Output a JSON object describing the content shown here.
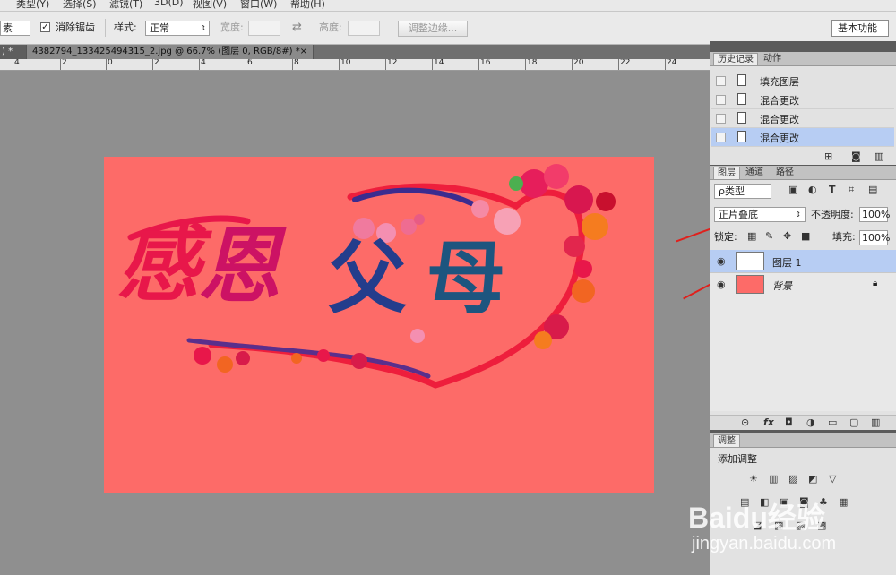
{
  "menu": [
    "类型(Y)",
    "选择(S)",
    "滤镜(T)",
    "3D(D)",
    "视图(V)",
    "窗口(W)",
    "帮助(H)"
  ],
  "options": {
    "feather_unit": "素",
    "antialias_label": "消除锯齿",
    "style_label": "样式:",
    "style_value": "正常",
    "width_label": "宽度:",
    "height_label": "高度:",
    "refine_edge": "调整边缘...",
    "workspace": "基本功能"
  },
  "tabs": [
    {
      "label": ") *"
    },
    {
      "label": "4382794_133425494315_2.jpg @ 66.7% (图层 0, RGB/8#) *"
    }
  ],
  "ruler_numbers": [
    "4",
    "2",
    "0",
    "2",
    "4",
    "6",
    "8",
    "10",
    "12",
    "14",
    "16",
    "18",
    "20",
    "22",
    "24"
  ],
  "artwork": {
    "chars": [
      "感",
      "恩",
      "父",
      "母"
    ],
    "colors": {
      "background": "#fd6b68",
      "left_text": "#e8174a",
      "right_text": "#1d4d8c",
      "heart": "#ee1e3c"
    }
  },
  "history_panel": {
    "tabs": [
      "历史记录",
      "动作"
    ],
    "items": [
      {
        "label": "填充图层",
        "selected": false
      },
      {
        "label": "混合更改",
        "selected": false
      },
      {
        "label": "混合更改",
        "selected": false
      },
      {
        "label": "混合更改",
        "selected": true
      }
    ]
  },
  "layers_panel": {
    "tabs": [
      "图层",
      "通道",
      "路径"
    ],
    "filter_label": "ρ类型",
    "blend_mode": "正片叠底",
    "opacity_label": "不透明度:",
    "opacity_value": "100%",
    "lock_label": "锁定:",
    "fill_label": "填充:",
    "fill_value": "100%",
    "layers": [
      {
        "name": "图层 1",
        "selected": true
      },
      {
        "name": "背景",
        "selected": false
      }
    ],
    "footer_icons": [
      "link-icon",
      "fx-icon",
      "mask-icon",
      "adjustment-icon",
      "group-icon",
      "new-layer-icon",
      "trash-icon"
    ]
  },
  "adjustments_panel": {
    "tab": "调整",
    "title": "添加调整"
  },
  "watermark": {
    "brand": "Baidu经验",
    "url": "jingyan.baidu.com"
  }
}
